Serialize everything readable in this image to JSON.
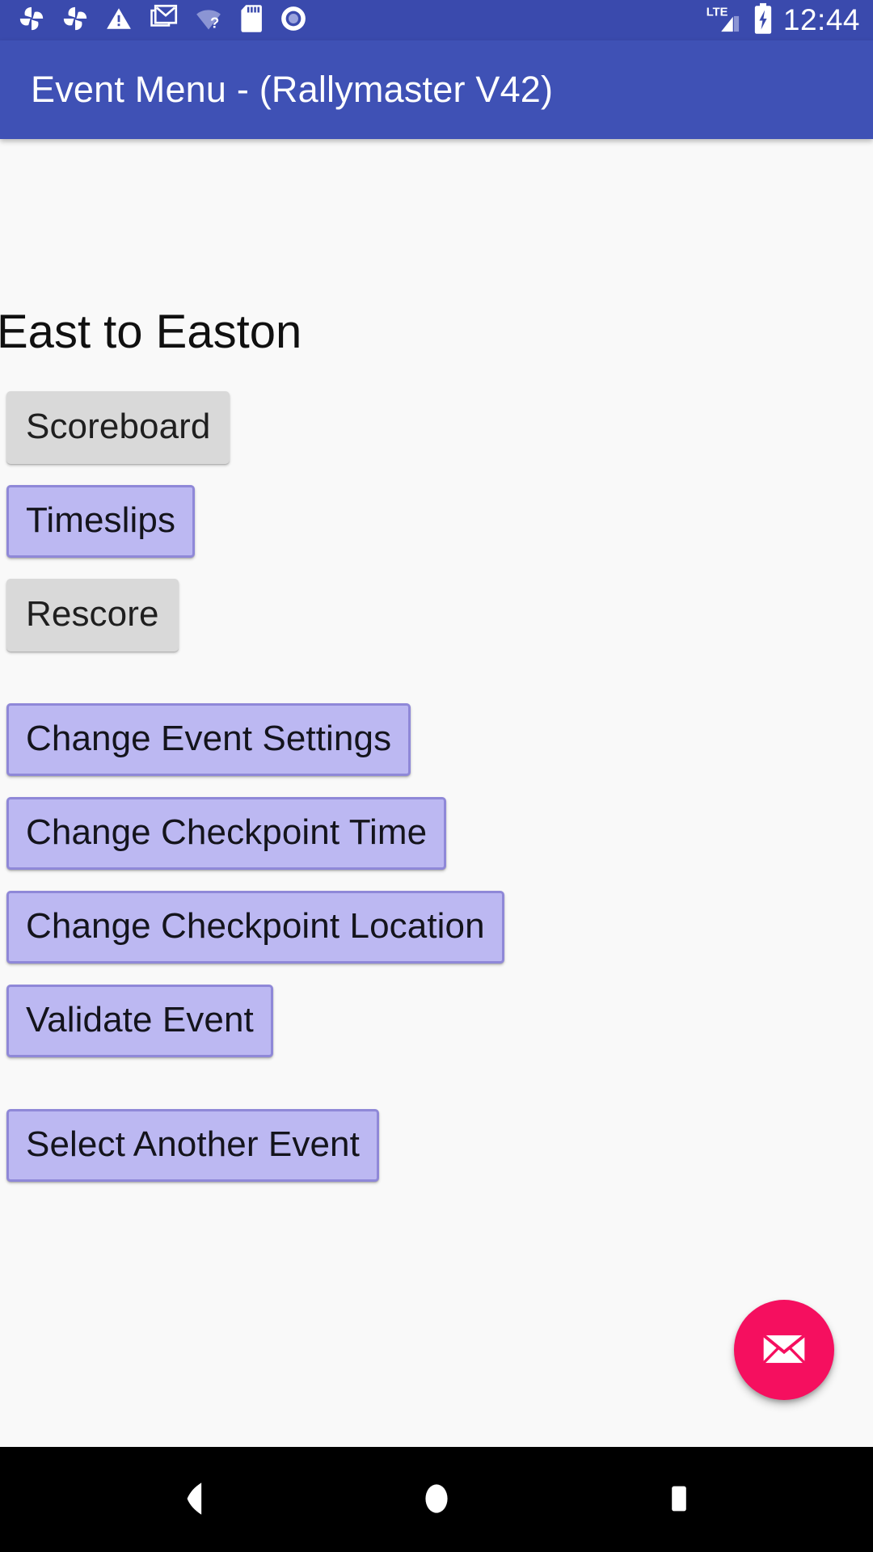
{
  "status_bar": {
    "background_color": "#3a4aad",
    "time": "12:44",
    "left_icons": [
      "pinwheel-icon",
      "pinwheel-icon",
      "warning-triangle-icon",
      "gmail-icon",
      "wifi-unknown-icon",
      "sd-card-icon",
      "disc-icon"
    ],
    "right_icons": [
      "lte-signal-icon",
      "battery-charging-icon"
    ],
    "network_label": "LTE"
  },
  "app_bar": {
    "title": "Event Menu - (Rallymaster V42)",
    "background_color": "#3f51b5"
  },
  "content": {
    "background_color": "#f9f9f9",
    "heading": "East to Easton",
    "buttons": [
      {
        "label": "Scoreboard",
        "style": "grey",
        "group": 1
      },
      {
        "label": "Timeslips",
        "style": "purple",
        "group": 1
      },
      {
        "label": "Rescore",
        "style": "grey",
        "group": 1
      },
      {
        "label": "Change Event Settings",
        "style": "purple",
        "group": 2
      },
      {
        "label": "Change Checkpoint Time",
        "style": "purple",
        "group": 2
      },
      {
        "label": "Change Checkpoint Location",
        "style": "purple",
        "group": 2
      },
      {
        "label": "Validate Event",
        "style": "purple",
        "group": 2
      },
      {
        "label": "Select Another Event",
        "style": "purple",
        "group": 3
      }
    ],
    "button_colors": {
      "grey_fill": "#d9d9d9",
      "purple_fill": "#bcb8f2",
      "purple_border": "#8f88d8",
      "text": "#1b1b20"
    }
  },
  "fab": {
    "icon": "envelope-icon",
    "color": "#f50f5f"
  },
  "nav_bar": {
    "background_color": "#000000",
    "buttons": [
      {
        "name": "back-button",
        "icon": "back-triangle-icon"
      },
      {
        "name": "home-button",
        "icon": "home-circle-icon"
      },
      {
        "name": "recents-button",
        "icon": "recents-square-icon"
      }
    ]
  }
}
